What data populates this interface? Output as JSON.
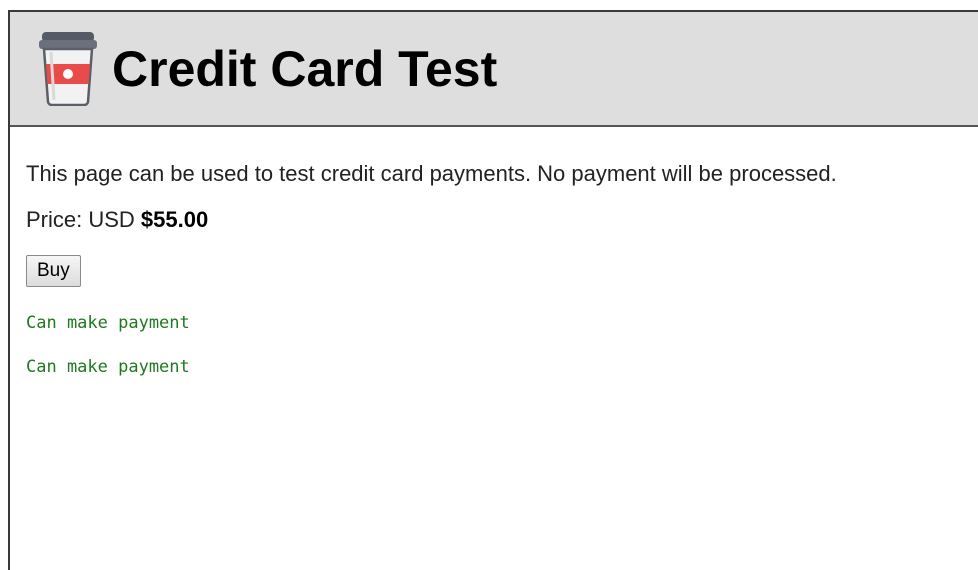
{
  "header": {
    "title": "Credit Card Test",
    "logo_icon": "coffee-cup-icon"
  },
  "main": {
    "description": "This page can be used to test credit card payments. No payment will be processed.",
    "price_label": "Price: USD ",
    "price_value": "$55.00",
    "buy_label": "Buy",
    "status_messages": [
      "Can make payment",
      "Can make payment"
    ]
  },
  "colors": {
    "header_bg": "#dedede",
    "status_green": "#1e7a1e",
    "logo_red": "#e94a4a"
  }
}
